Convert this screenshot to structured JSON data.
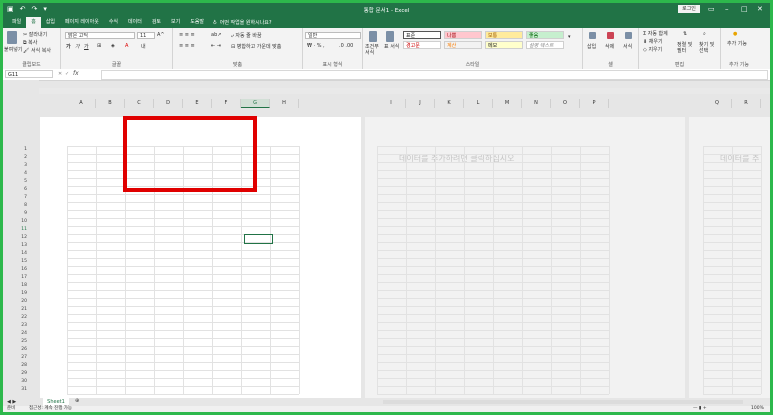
{
  "title_bar": {
    "doc_title": "통합 문서1 - Excel",
    "login_label": "로그인"
  },
  "tabs": [
    "파일",
    "홈",
    "삽입",
    "페이지 레이아웃",
    "수식",
    "데이터",
    "검토",
    "보기",
    "도움말"
  ],
  "tell_me": "어떤 작업을 원하시나요?",
  "ribbon": {
    "clipboard": {
      "paste": "붙여넣기",
      "cut": "잘라내기",
      "copy": "복사",
      "format_painter": "서식 복사",
      "label": "클립보드"
    },
    "font": {
      "name": "맑은 고딕",
      "size": "11",
      "label": "글꼴"
    },
    "alignment": {
      "wrap": "자동 줄 바꿈",
      "merge": "병합하고 가운데 맞춤",
      "label": "맞춤"
    },
    "number": {
      "format": "일반",
      "label": "표시 형식"
    },
    "styles": {
      "conditional": "조건부 서식",
      "table_format": "표 서식",
      "normal": "표준",
      "bad": "나쁨",
      "good": "보통",
      "neutral": "좋음",
      "warning": "경고문",
      "calc": "계산",
      "note": "메모",
      "explanatory": "설명 텍스트",
      "label": "스타일"
    },
    "cells": {
      "insert": "삽입",
      "delete": "삭제",
      "format": "서식",
      "label": "셀"
    },
    "editing": {
      "autosum": "자동 합계",
      "fill": "채우기",
      "clear": "지우기",
      "sort": "정렬 및 필터",
      "find": "찾기 및 선택",
      "label": "편집"
    },
    "addins": {
      "add": "추가 기능",
      "label": "추가 기능"
    }
  },
  "formula_bar": {
    "name_box": "G11",
    "fx": "fx"
  },
  "columns_left": [
    "A",
    "B",
    "C",
    "D",
    "E",
    "F",
    "G",
    "H"
  ],
  "columns_mid": [
    "I",
    "J",
    "K",
    "L",
    "M",
    "N",
    "O",
    "P"
  ],
  "columns_right": [
    "Q",
    "R"
  ],
  "selected_column": "G",
  "rows": [
    "1",
    "2",
    "3",
    "4",
    "5",
    "6",
    "7",
    "8",
    "9",
    "10",
    "11",
    "12",
    "13",
    "14",
    "15",
    "16",
    "17",
    "18",
    "19",
    "20",
    "21",
    "22",
    "23",
    "24",
    "25",
    "26",
    "27",
    "28",
    "29",
    "30",
    "31"
  ],
  "selected_row": "11",
  "placeholder_text": "데이터를 추가하려면 클릭하십시오",
  "placeholder_text_cut": "데이터를 추",
  "sheet_tab": "Sheet1",
  "status": {
    "left": "준비",
    "accessibility": "접근성: 계속 진행 가능",
    "zoom": "100%"
  },
  "colors": {
    "excel_green": "#217346",
    "highlight_red": "#e00000",
    "frame_green": "#2db84c"
  }
}
